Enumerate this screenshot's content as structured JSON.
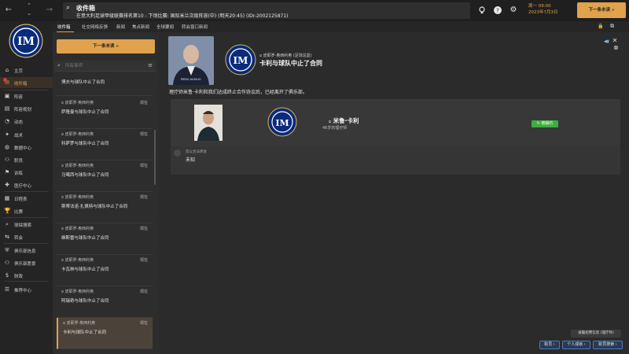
{
  "topbar": {
    "title": "收件箱",
    "subtitle": "在意大利足球甲级联赛排名第10 - 下场比赛: 国际米兰次级阵容(中) (明天20:45) (IDr-2002125871)",
    "date_line1": "周一 09:00",
    "date_line2": "2023年7月3日",
    "continue_label": "下一条未读"
  },
  "nav": {
    "items": [
      {
        "label": "主页",
        "icon": "home-icon"
      },
      {
        "label": "收件箱",
        "icon": "inbox-icon",
        "active": true
      },
      {
        "label": "阵容",
        "icon": "squad-icon"
      },
      {
        "label": "阵容规划",
        "icon": "squad-planner-icon"
      },
      {
        "label": "动态",
        "icon": "dynamics-icon"
      },
      {
        "label": "战术",
        "icon": "tactics-icon"
      },
      {
        "label": "数据中心",
        "icon": "data-hub-icon"
      },
      {
        "label": "职员",
        "icon": "staff-icon"
      },
      {
        "label": "训练",
        "icon": "training-icon"
      },
      {
        "label": "医疗中心",
        "icon": "medical-icon"
      },
      {
        "label": "日程表",
        "icon": "schedule-icon"
      },
      {
        "label": "比赛",
        "icon": "competitions-icon"
      },
      {
        "label": "球探搜索",
        "icon": "scouting-icon"
      },
      {
        "label": "转会",
        "icon": "transfers-icon"
      },
      {
        "label": "俱乐部信息",
        "icon": "club-info-icon"
      },
      {
        "label": "俱乐部愿景",
        "icon": "club-vision-icon"
      },
      {
        "label": "财政",
        "icon": "finances-icon"
      },
      {
        "label": "推荐中心",
        "icon": "dev-centre-icon"
      }
    ]
  },
  "tabs": [
    "收件箱",
    "社交网络反馈",
    "新闻",
    "焦点新闻",
    "全球要闻",
    "转会窗口新闻"
  ],
  "list": {
    "continue_label": "下一条未读",
    "search_placeholder": "所有事项",
    "messages": [
      {
        "sender": "",
        "time": "",
        "subject": "博夫与球队中止了合同"
      },
      {
        "sender": "皮耶罗·奥西利奥",
        "time": "现在",
        "subject": "萨隆曼与球队中止了合同"
      },
      {
        "sender": "皮耶罗·奥西利奥",
        "time": "现在",
        "subject": "科萨罗与球队中止了合同"
      },
      {
        "sender": "皮耶罗·奥西利奥",
        "time": "现在",
        "subject": "马噶西与球队中止了合同"
      },
      {
        "sender": "皮耶罗·奥西利奥",
        "time": "现在",
        "subject": "斯蒂法诺·扎佩特与球队中止了合同"
      },
      {
        "sender": "皮耶罗·奥西利奥",
        "time": "现在",
        "subject": "维斯雷与球队中止了合同"
      },
      {
        "sender": "皮耶罗·奥西利奥",
        "time": "现在",
        "subject": "卡瓦林与球队中止了合同"
      },
      {
        "sender": "皮耶罗·奥西利奥",
        "time": "现在",
        "subject": "阿瑞奇与球队中止了合同"
      },
      {
        "sender": "皮耶罗·奥西利奥",
        "time": "现在",
        "subject": "卡利与球队中止了合同",
        "selected": true
      }
    ]
  },
  "detail": {
    "sender": "皮耶罗·奥西利奥 (足球总监)",
    "title": "卡利与球队中止了合同",
    "body": "理疗师米鲁·卡利和我们达成终止合作协议后，已经离开了俱乐部。",
    "person_name": "米鲁·卡利",
    "person_desc": "46岁的理疗师",
    "status_badge": "被解约",
    "reply_label": "您以合法转会",
    "reply_value": "未知",
    "photo_caption": "PIERO AUSILIO"
  },
  "bottom": {
    "tooltip": "披露招聘信息 (理疗师)",
    "buttons": [
      "职员",
      "个人成就",
      "职员搜索"
    ]
  },
  "colors": {
    "accent": "#e0a24c",
    "badge_green": "#3fae3f",
    "bottom_btn_border": "#4a7ab8"
  }
}
